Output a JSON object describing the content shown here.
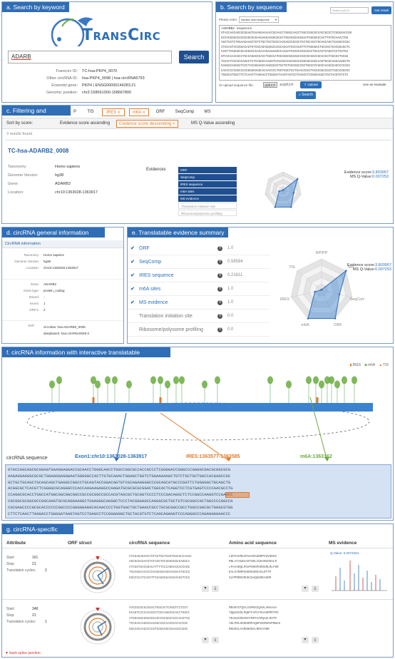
{
  "panels": {
    "a": "a. Search by keyword",
    "b": "b. Search by sequence",
    "c": "c. Filtering and ranking",
    "d": "d. circRNA general information",
    "e": "e. Translatable evidence summary",
    "f": "f. circRNA information with interactive translatable evidences",
    "g": "g. circRNA-specific ORF"
  },
  "search_keyword": {
    "logo_text": "TransCirc",
    "query": "ADARB",
    "search_button": "Search",
    "fields": [
      {
        "label": "Transcirc ID:",
        "value": "TC-hsa-PKP4_0070"
      },
      {
        "label": "Other circRNA ID:",
        "value": "hsa-PKP4_0098 | hsa-circRNA5793"
      },
      {
        "label": "Ensembl gene:",
        "value": "PKP4 | ENSG00000144283.21"
      },
      {
        "label": "Genomic position:",
        "value": "chr2:158661000-158667800"
      }
    ]
  },
  "search_sequence": {
    "job_placeholder": "Search job ID",
    "get_result": "Get result",
    "please_enter": "Please enter",
    "type_select": "Nucleic acid sequence",
    "seq_header": ">ADARB2 sequence",
    "seq_lines": [
      "GTACCAGCAGCGCGGAGTGAAGGAGAACCGCAACCTGGGCAACCTGGCCGGCGCCACCGCCCTCGGGGACCGG",
      "GCCCGGGGCGACGCGGCGCGAAGAGGAAGGCGCGCTGGAGGGAGGGAATGGGGGCCACTTGTGCAAACTGG",
      "AGCTGGTCTGGAAGAAGCTGTCTGCTGCTGGCCACGAGCCGCGCTGCTGCAGCTGCAGCAGCTGAGGCCGGC",
      "CTGCAGTACCGGACAGTGTCGCAGAGGGGCCCGCAGCATGCCCGGTTCTGGGGGCTGCAGCTGACGGCGCTC",
      "ACGTTCGGGGCGCAGGGCCCACCAAGAAGAGGCCAAGATGCGCGCGCGGACTGGCACTCAGGTCCTCGTGA",
      "GTCCCCAACGCCTGCCAGGCGCACCTGGCCATGGCGGCGGCGGCCGCCGCGGCCGCCACGTAGCGCTGCGG",
      "TCCCCTCCCGACAGGCTCTCCGGCCAAGGTCCGAGCCCGCGGCGCGGCGCCGGCAAGTGCGCAGGAAGGCTG",
      "GAGGGCAGGGCTCCCTACGGGAGCCAGGGCGCTGCTGTCGCGGCCGCTGGCCCCGGCCACGCGAGCCCCGCG",
      "CACCCCCCGGCCCCGGGGGAGGCACAACCCCTGGTGGCTGCTGAACCGCCTGCGCGGCCGCCTGGCCGGCGC",
      "TGGGCGTGGCTTCTCAACTTAGGACCTGGGGATAAGTAGTCCTGAGCCTCCGGGAGGCTGCTACGTGTCTC"
    ],
    "upload_label": "Or upload sequence file:",
    "choose_file": "选择文件",
    "no_file": "未选择文件",
    "upload_button": "Upload",
    "use_example": "Use an example",
    "search_button": "Search"
  },
  "filtering": {
    "filter_tags": [
      "P",
      "TIS",
      "IRES",
      "m6A",
      "ORF",
      "SeqComp",
      "MS"
    ],
    "active_filters": [
      "IRES",
      "m6A"
    ],
    "sort_label": "Sort by score:",
    "sort_options": [
      "Evidence score ascending",
      "Evidence score descending",
      "MS Q-Value ascending"
    ],
    "active_sort": "Evidence score descending",
    "results_found": "3 results found",
    "result": {
      "id": "TC-hsa-ADARB2_0008",
      "rows": [
        {
          "label": "Taxonomy:",
          "value": "Homo sapiens"
        },
        {
          "label": "Genome Version:",
          "value": "hg38"
        },
        {
          "label": "Gene:",
          "value": "ADARB2"
        },
        {
          "label": "Location:",
          "value": "chr10:1363028-1363917"
        }
      ],
      "evidences_label": "Evidences",
      "evidences": [
        {
          "name": "ORF",
          "on": true
        },
        {
          "name": "SeqComp",
          "on": true
        },
        {
          "name": "IRES sequence",
          "on": true
        },
        {
          "name": "m6A sites",
          "on": true
        },
        {
          "name": "MS evidence",
          "on": true
        },
        {
          "name": "Translation initiation site",
          "on": false
        },
        {
          "name": "Ribosome/polysome profiling",
          "on": false
        }
      ],
      "evidence_score_label": "Evidence score:",
      "evidence_score": "3.803957",
      "ms_label": "MS Q-Value:",
      "ms_value": "0.007253"
    }
  },
  "general_info": {
    "header": "CircRNA information",
    "rows1": [
      {
        "label": "Taxonomy:",
        "value": "Homo sapiens"
      },
      {
        "label": "Genome Version:",
        "value": "hg38"
      },
      {
        "label": "Location:",
        "value": "chr10:1363028-1363917"
      }
    ],
    "rows2": [
      {
        "label": "Gene:",
        "value": "ADARB2"
      },
      {
        "label": "Gene type:",
        "value": "protein_coding"
      },
      {
        "label": "Strand:",
        "value": "-"
      },
      {
        "label": "exons:",
        "value": "1"
      },
      {
        "label": "ORF's:",
        "value": "2"
      }
    ],
    "xref_label": "Xref:",
    "xrefs": [
      "circAtlas: hsa-ADARB2_0005",
      "deepbase2: hsa-circRNA0029-2"
    ]
  },
  "evidence_summary": {
    "rows": [
      {
        "name": "ORF",
        "checked": true,
        "value": "1.0"
      },
      {
        "name": "SeqComp",
        "checked": true,
        "value": "0.58584"
      },
      {
        "name": "IRES sequence",
        "checked": true,
        "value": "0.21811"
      },
      {
        "name": "m6A sites",
        "checked": true,
        "value": "1.0"
      },
      {
        "name": "MS evidence",
        "checked": true,
        "value": "1.0"
      },
      {
        "name": "Translation initiation site",
        "checked": false,
        "value": "0.0"
      },
      {
        "name": "Ribosome/polysome profiling",
        "checked": false,
        "value": "0.0"
      }
    ],
    "score_label": "Evidence score:",
    "score": "3.803957",
    "ms_label": "MS Q-Value:",
    "ms": "0.007253",
    "radar_axes": [
      "RP/PP",
      "MS",
      "SeqComp",
      "ORF",
      "m6A",
      "IRES",
      "TIS"
    ],
    "radar_values": [
      0.0,
      1.0,
      0.58584,
      1.0,
      1.0,
      0.21811,
      0.0
    ]
  },
  "circ_info": {
    "legend": [
      "IRES",
      "m6A",
      "TIS"
    ],
    "seq_label": "circRNA sequence",
    "exon_label": "Exon1:chr10:1363028-1363917",
    "ires_label": "IRES:1363577-1363585",
    "m6a_label": "m6A:1363162",
    "seq_lines": [
      "GTACCAGCAGCGCGGAGTGAAGGAGAACCGCAACCTGGGCAACCTGGCCGGCGCCACCGCCCTCGGGGACCGGGCCCGGGGCGACGCGGCGCG",
      "AAGAGGAAGGCGCGCTGGAGGGAGGGAATGGGGGCCACTTGTGCAAACTGGAGCTGGTCTGGAAGAAGCTGTCTGCTGCTGGCCACGAGCCGC",
      "GCTGCTGCAGCTGCAGCAGCTGAGGCCGGCCTGCAGTACCGGACAGTGTCGCAGAGGGGCCCGCAGCATGCCCGGTTCTGGGGGCTGCAGCTG",
      "ACGGCGCTCACGTTCGGGGCGCAGGGCCCACCAAGAAGAGGCCAAGATGCGCGCGCGGACTGGCACTCAGGTCCTCGTGAGTCCCCAACGCCTG",
      "CCAGGCGCACCTGGCCATGGCGGCGGCGGCCGCCGCGGCCGCCACGTAGCGCTGCGGTCCCCTCCCGACAGGCTCTCCGGCCAAGGTCCGAGCC",
      "CGCGGCGCGGCGCCGGCAAGTGCGCAGGAAGGCTGGAGGGCAGGGCTCCCTACGGGAGCCAGGGCGCTGCTGTCGCGGCCGCTGGCCCCGGCCA",
      "CGCGAGCCCCGCGCACCCCCCGGCCCCGGGGGAGGCACAACCCCTGGTGGCTGCTGAACCGCCTGCGCGGCCGCCTGGCCGGCGCTGGGCGTGG",
      "CTTCTCAACTTAGGACCTGGGGATAAGTAGTCCTGAGCCTCCGGGAGGCTGCTACGTGTCTCAGCAGAGGTCCCAGGGCCCAGAGGAGAACCC"
    ]
  },
  "orf": {
    "headers": [
      "Attribute",
      "ORF struct",
      "circRNA sequence",
      "Amino acid sequence",
      "MS evidence"
    ],
    "ms_qvalue": "Q-Value: 0.0072534",
    "back_splice": "back splice junction",
    "rows": [
      {
        "start_label": "Start:",
        "start": "161",
        "stop_label": "Stop:",
        "stop": "21",
        "cycles_label": "Translation cycles:",
        "cycles": "2",
        "nt": [
          "CTGGAGAGAGCTGTCGTGGTCGGTGGCGCCAAGA",
          "AGCGCGCGACGTGTCGGTGCGGGGGGCGAGGCA",
          "CTCGGTGACGGACATTTTCCCAGGACGACCCGG",
          "TCGAGGCAACCCCGAGGGGAGGACGGAATGCCG",
          "GGCCCCATCACGTTCGAGGGGACGGACGGTCCG"
        ],
        "aa": [
          "LEPAVVRGAPAGARAGRRPVSVSRGG",
          "RRLATAGNAASTGRLIGEARGGRALR",
          "LPAAVDQLPGAPGRGPGRSGRLRLFDR",
          "EALGYRRPGHGRGSRGAGLRTTP",
          "SLPPRRDVRHGCGAQGGREAGRR"
        ]
      },
      {
        "start_label": "Start:",
        "start": "348",
        "stop_label": "Stop:",
        "stop": "21",
        "cycles_label": "Translation cycles:",
        "cycles": "1",
        "nt": [
          "ATGCGCGCGCGGACTGGCACTCAGGTCCTCGT",
          "GCAGTCCCCAACGCCTGCCAGGCGCACCTGGCC",
          "ATGGCGGCGGCGGCCGCCGCGGCCGCCACGTAG",
          "TCCGACCAGGCGAAGGCCGCCACGCCCCCCGC",
          "GGCCGCCAGCCCCGTCGGCGGCCGACGCCGGC"
        ],
        "aa": [
          "MRARTGTQVLVSPNACQAHLAMAAAA",
          "TQQADVDLPQHFFAPLFRAAGRPRTPS",
          "TEAGGCRSARATRRTAAPQAGLRSTP",
          "ARLPRLHGRGRRPAQKPGKRGRVPRWAS",
          "RKGRVLAARGRGRALRRVAARR"
        ]
      }
    ]
  },
  "colors": {
    "title_bg": "#2f6db5",
    "accent_orange": "#e07a2a",
    "accent_green": "#6aab3e",
    "blue": "#2c6fb7"
  }
}
